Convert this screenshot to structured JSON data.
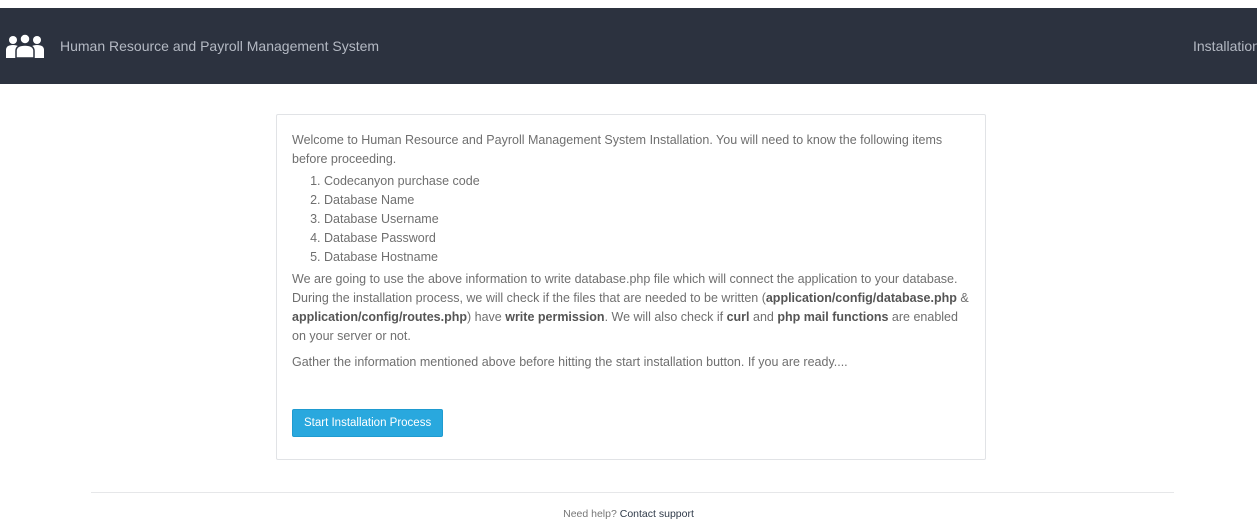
{
  "navbar": {
    "title": "Human Resource and Payroll Management System",
    "right_label": "Installation"
  },
  "panel": {
    "intro": "Welcome to Human Resource and Payroll Management System Installation. You will need to know the following items before proceeding.",
    "items": [
      "Codecanyon purchase code",
      "Database Name",
      "Database Username",
      "Database Password",
      "Database Hostname"
    ],
    "para2": {
      "t1": "We are going to use the above information to write database.php file which will connect the application to your database. During the installation process, we will check if the files that are needed to be written (",
      "b1": "application/config/database.php",
      "t2": " & ",
      "b2": "application/config/routes.php",
      "t3": ") have ",
      "b3": "write permission",
      "t4": ". We will also check if ",
      "b4": "curl",
      "t5": " and ",
      "b5": "php mail functions",
      "t6": " are enabled on your server or not."
    },
    "para3": "Gather the information mentioned above before hitting the start installation button. If you are ready....",
    "button_label": "Start Installation Process"
  },
  "footer": {
    "help_text": "Need help?",
    "link_text": "Contact support"
  },
  "colors": {
    "navbar_bg": "#2c323f",
    "button_bg": "#29a8de"
  },
  "icons": {
    "brand": "users-group-icon"
  }
}
